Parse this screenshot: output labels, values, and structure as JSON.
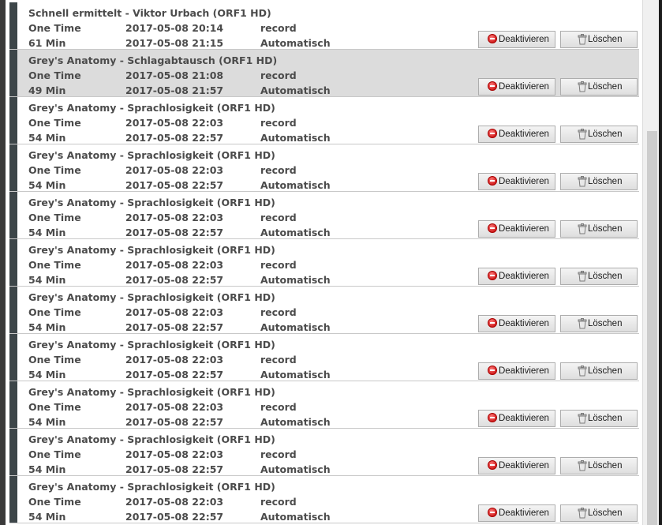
{
  "buttons": {
    "deactivate": "Deaktivieren",
    "delete": "Löschen"
  },
  "timers": [
    {
      "title": "Schnell ermittelt - Viktor Urbach (ORF1 HD)",
      "type": "One Time",
      "duration": "61 Min",
      "start": "2017-05-08 20:14",
      "end": "2017-05-08 21:15",
      "action": "record",
      "mode": "Automatisch",
      "selected": false
    },
    {
      "title": "Grey's Anatomy - Schlagabtausch (ORF1 HD)",
      "type": "One Time",
      "duration": "49 Min",
      "start": "2017-05-08 21:08",
      "end": "2017-05-08 21:57",
      "action": "record",
      "mode": "Automatisch",
      "selected": true
    },
    {
      "title": "Grey's Anatomy - Sprachlosigkeit (ORF1 HD)",
      "type": "One Time",
      "duration": "54 Min",
      "start": "2017-05-08 22:03",
      "end": "2017-05-08 22:57",
      "action": "record",
      "mode": "Automatisch",
      "selected": false
    },
    {
      "title": "Grey's Anatomy - Sprachlosigkeit (ORF1 HD)",
      "type": "One Time",
      "duration": "54 Min",
      "start": "2017-05-08 22:03",
      "end": "2017-05-08 22:57",
      "action": "record",
      "mode": "Automatisch",
      "selected": false
    },
    {
      "title": "Grey's Anatomy - Sprachlosigkeit (ORF1 HD)",
      "type": "One Time",
      "duration": "54 Min",
      "start": "2017-05-08 22:03",
      "end": "2017-05-08 22:57",
      "action": "record",
      "mode": "Automatisch",
      "selected": false
    },
    {
      "title": "Grey's Anatomy - Sprachlosigkeit (ORF1 HD)",
      "type": "One Time",
      "duration": "54 Min",
      "start": "2017-05-08 22:03",
      "end": "2017-05-08 22:57",
      "action": "record",
      "mode": "Automatisch",
      "selected": false
    },
    {
      "title": "Grey's Anatomy - Sprachlosigkeit (ORF1 HD)",
      "type": "One Time",
      "duration": "54 Min",
      "start": "2017-05-08 22:03",
      "end": "2017-05-08 22:57",
      "action": "record",
      "mode": "Automatisch",
      "selected": false
    },
    {
      "title": "Grey's Anatomy - Sprachlosigkeit (ORF1 HD)",
      "type": "One Time",
      "duration": "54 Min",
      "start": "2017-05-08 22:03",
      "end": "2017-05-08 22:57",
      "action": "record",
      "mode": "Automatisch",
      "selected": false
    },
    {
      "title": "Grey's Anatomy - Sprachlosigkeit (ORF1 HD)",
      "type": "One Time",
      "duration": "54 Min",
      "start": "2017-05-08 22:03",
      "end": "2017-05-08 22:57",
      "action": "record",
      "mode": "Automatisch",
      "selected": false
    },
    {
      "title": "Grey's Anatomy - Sprachlosigkeit (ORF1 HD)",
      "type": "One Time",
      "duration": "54 Min",
      "start": "2017-05-08 22:03",
      "end": "2017-05-08 22:57",
      "action": "record",
      "mode": "Automatisch",
      "selected": false
    },
    {
      "title": "Grey's Anatomy - Sprachlosigkeit (ORF1 HD)",
      "type": "One Time",
      "duration": "54 Min",
      "start": "2017-05-08 22:03",
      "end": "2017-05-08 22:57",
      "action": "record",
      "mode": "Automatisch",
      "selected": false
    }
  ]
}
